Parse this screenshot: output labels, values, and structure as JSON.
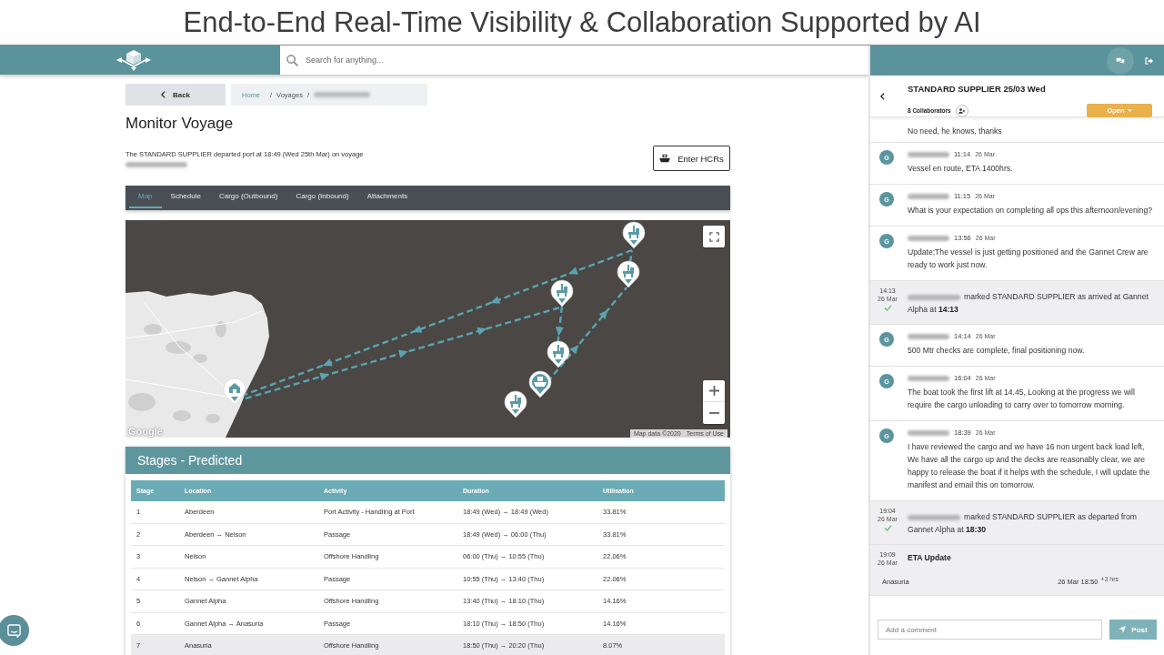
{
  "slide_title": "End-to-End Real-Time Visibility & Collaboration Supported by AI",
  "topbar": {
    "search": {
      "placeholder": "Search for anything..."
    }
  },
  "page": {
    "back_button": "Back",
    "breadcrumb": {
      "separator": "/",
      "items": [
        {
          "kind": "link",
          "label": "Home"
        },
        {
          "kind": "text",
          "label": "Voyages"
        },
        {
          "kind": "blurred"
        }
      ]
    },
    "title": "Monitor Voyage",
    "status": {
      "text": "The STANDARD SUPPLIER departed port at 18:49 (Wed 25th Mar) on voyage",
      "voyage_blurred": true
    },
    "hcr_button": "Enter HCRs",
    "tabs": [
      {
        "label": "Map",
        "selected": true
      },
      {
        "label": "Schedule",
        "selected": false
      },
      {
        "label": "Cargo (Outbound)",
        "selected": false
      },
      {
        "label": "Cargo (Inbound)",
        "selected": false
      },
      {
        "label": "Attachments",
        "selected": false
      }
    ],
    "map": {
      "logo": "Google",
      "attribution": "Map data ©2020",
      "terms": "Terms of Use"
    },
    "stages": {
      "title": "Stages - Predicted",
      "columns": [
        "Stage",
        "Location",
        "Activity",
        "Duration",
        "Utilisation"
      ],
      "rows": [
        {
          "cells": [
            "1",
            "Aberdeen",
            "Port Activity - Handling at Port",
            "18:49 (Wed) → 18:49 (Wed)",
            "33.81%"
          ],
          "selected": false
        },
        {
          "cells": [
            "2",
            "Aberdeen → Nelson",
            "Passage",
            "18:49 (Wed) → 06:00 (Thu)",
            "33.81%"
          ],
          "selected": false
        },
        {
          "cells": [
            "3",
            "Nelson",
            "Offshore Handling",
            "06:00 (Thu) → 10:55 (Thu)",
            "22.06%"
          ],
          "selected": false
        },
        {
          "cells": [
            "4",
            "Nelson → Gannet Alpha",
            "Passage",
            "10:55 (Thu) → 13:40 (Thu)",
            "22.06%"
          ],
          "selected": false
        },
        {
          "cells": [
            "5",
            "Gannet Alpha",
            "Offshore Handling",
            "13:40 (Thu) → 18:10 (Thu)",
            "14.16%"
          ],
          "selected": false
        },
        {
          "cells": [
            "6",
            "Gannet Alpha → Anasuria",
            "Passage",
            "18:10 (Thu) → 18:50 (Thu)",
            "14.16%"
          ],
          "selected": false
        },
        {
          "cells": [
            "7",
            "Anasuria",
            "Offshore Handling",
            "18:50 (Thu) → 20:20 (Thu)",
            "8.07%"
          ],
          "selected": true
        }
      ]
    }
  },
  "chat": {
    "title": "STANDARD SUPPLIER 25/03 Wed",
    "collaborators": "8 Collaborators",
    "status_button": "Open",
    "messages": [
      {
        "kind": "comment",
        "text": "No need, he knows, thanks"
      },
      {
        "kind": "comment",
        "avatar": "G",
        "sender_blurred": true,
        "time": "11:14",
        "date": "26 Mar",
        "text": "Vessel en route, ETA 1400hrs."
      },
      {
        "kind": "comment",
        "avatar": "G",
        "sender_blurred": true,
        "time": "11:15",
        "date": "26 Mar",
        "text": "What is your expectation on completing all ops this afternoon/evening?"
      },
      {
        "kind": "comment",
        "avatar": "G",
        "sender_blurred": true,
        "time": "13:56",
        "date": "26 Mar",
        "text": "Update;The vessel is just getting positioned and the Gannet Crew are ready to work just now."
      },
      {
        "kind": "event",
        "time": "14:13",
        "date": "26 Mar",
        "confirmed": true,
        "actor_blurred": true,
        "text": "marked STANDARD SUPPLIER as arrived at Gannet Alpha at **14:13**"
      },
      {
        "kind": "comment",
        "avatar": "G",
        "sender_blurred": true,
        "time": "14:14",
        "date": "26 Mar",
        "text": "500 Mtr checks are complete, final positioning now."
      },
      {
        "kind": "comment",
        "avatar": "G",
        "sender_blurred": true,
        "time": "16:04",
        "date": "26 Mar",
        "text": "The boat took the first lift at 14.45, Looking at the progress we will require the cargo unloading to carry over to tomorrow morning."
      },
      {
        "kind": "comment",
        "avatar": "G",
        "sender_blurred": true,
        "time": "18:39",
        "date": "26 Mar",
        "text": "I have reviewed the cargo and we have 16 non urgent back load left, We have all the cargo up and the decks are reasonably clear, we are happy to release the boat if it helps with the schedule, I will update the manifest and email this on tomorrow."
      },
      {
        "kind": "event",
        "time": "19:04",
        "date": "26 Mar",
        "confirmed": true,
        "actor_blurred": true,
        "text": "marked STANDARD SUPPLIER as departed from Gannet Alpha at **18:30**"
      },
      {
        "kind": "eta",
        "time": "19:09",
        "date": "26 Mar",
        "title": "ETA Update",
        "location": "Anasuria",
        "eta": "26 Mar 18:50",
        "change": "+3 hrs"
      }
    ],
    "comment_field": {
      "placeholder": "Add a comment"
    },
    "post_button": "Post"
  }
}
